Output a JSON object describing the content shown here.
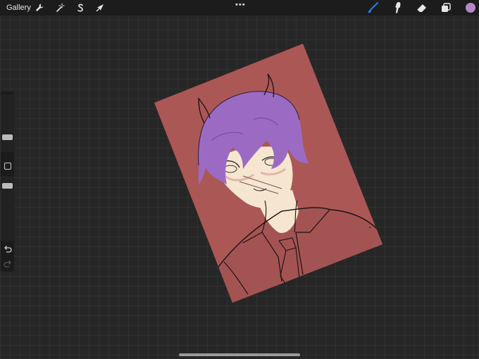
{
  "topbar": {
    "gallery_label": "Gallery",
    "left_tools": [
      {
        "name": "actions",
        "icon": "wrench-icon"
      },
      {
        "name": "adjustments",
        "icon": "magic-wand-icon"
      },
      {
        "name": "selection",
        "icon": "selection-s-icon"
      },
      {
        "name": "transform",
        "icon": "arrow-cursor-icon"
      }
    ],
    "more_label": "•••",
    "right_tools": [
      {
        "name": "brush",
        "icon": "brush-icon",
        "active": true
      },
      {
        "name": "smudge",
        "icon": "smudge-icon"
      },
      {
        "name": "eraser",
        "icon": "eraser-icon"
      },
      {
        "name": "layers",
        "icon": "layers-icon"
      }
    ],
    "current_color": "#b587c8"
  },
  "sidebar": {
    "brush_size_level": 0.35,
    "opacity_level": 0.25,
    "modify_button": "square-icon",
    "undo_icon": "undo-icon",
    "redo_icon": "redo-icon"
  },
  "canvas": {
    "background_color": "#ab5756",
    "hair_color": "#9b6bc4",
    "skin_color": "#f6e6cf",
    "suit_color": "#a45353"
  },
  "colors": {
    "active_tool": "#2d7be6",
    "toolbar_bg": "#1c1c1c"
  }
}
